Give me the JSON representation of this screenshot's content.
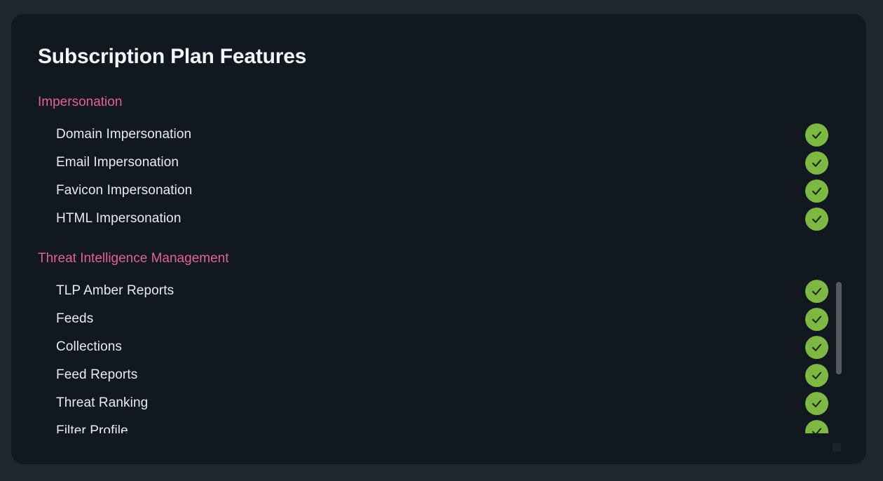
{
  "card": {
    "title": "Subscription Plan Features",
    "colors": {
      "page_background": "#1e272b",
      "card_background": "#111820",
      "title_text": "#f2f4f6",
      "section_heading": "#e25fa2",
      "item_text": "#e9ebee",
      "check_badge": "#7cb842",
      "check_mark": "#1c2a14",
      "scrollbar_thumb": "#565a5c"
    },
    "sections": [
      {
        "heading": "Impersonation",
        "items": [
          {
            "label": "Domain Impersonation",
            "status_icon": "check-circle-icon",
            "included": true
          },
          {
            "label": "Email Impersonation",
            "status_icon": "check-circle-icon",
            "included": true
          },
          {
            "label": "Favicon Impersonation",
            "status_icon": "check-circle-icon",
            "included": true
          },
          {
            "label": "HTML Impersonation",
            "status_icon": "check-circle-icon",
            "included": true
          }
        ]
      },
      {
        "heading": "Threat Intelligence Management",
        "items": [
          {
            "label": "TLP Amber Reports",
            "status_icon": "check-circle-icon",
            "included": true
          },
          {
            "label": "Feeds",
            "status_icon": "check-circle-icon",
            "included": true
          },
          {
            "label": "Collections",
            "status_icon": "check-circle-icon",
            "included": true
          },
          {
            "label": "Feed Reports",
            "status_icon": "check-circle-icon",
            "included": true
          },
          {
            "label": "Threat Ranking",
            "status_icon": "check-circle-icon",
            "included": true
          },
          {
            "label": "Filter Profile",
            "status_icon": "check-circle-icon",
            "included": true
          }
        ]
      }
    ],
    "scrollbar": {
      "orientation": "vertical",
      "visible": true
    }
  }
}
